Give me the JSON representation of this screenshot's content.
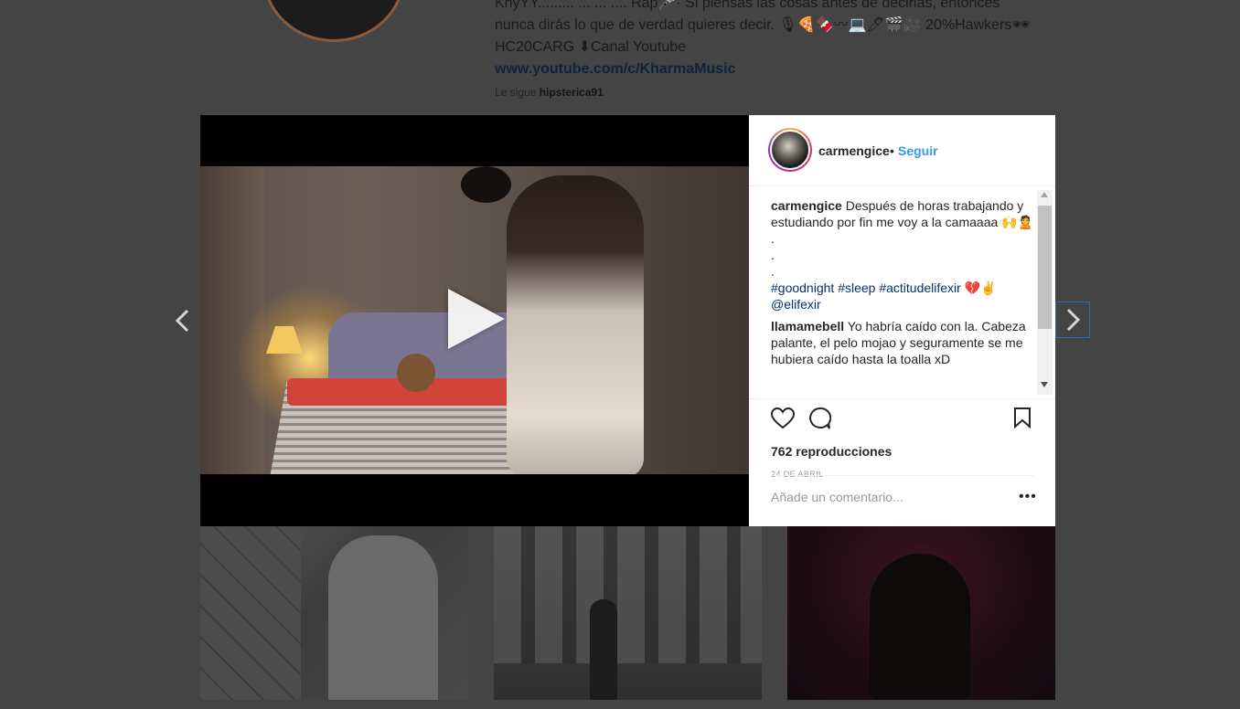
{
  "profile_bg": {
    "bio_line1": "KhyYY......... ... ... ....  Rap🎤· Si piensas las cosas antes de decirlas, entonces",
    "bio_line2": "nunca dirás lo que de verdad quieres decir. 🎙🍕🍫〰💻🖊🎬🎥  20%Hawkers🕶",
    "bio_line3": "HC20CARG ⬇Canal Youtube",
    "link": "www.youtube.com/c/KharmaMusic",
    "followed_by_label": "Le sigue",
    "followed_by_user": "hipsterica91"
  },
  "post": {
    "username": "carmengice",
    "separator": "•",
    "follow_label": "Seguir",
    "caption_user": "carmengice",
    "caption_text": "Después de horas trabajando y estudiando por fin me voy a la camaaaa 🙌🙎",
    "caption_dots": [
      ".",
      ".",
      "."
    ],
    "hashtags": [
      "#goodnight",
      "#sleep",
      "#actitudelifexir"
    ],
    "hashtag_emoji": "💔✌",
    "mention": "@elifexir",
    "comment_user": "llamamebell",
    "comment_text": "Yo habría caído con la. Cabeza palante, el pelo mojao y seguramente se me hubiera caído hasta la toalla xD",
    "views": "762 reproducciones",
    "date": "24 DE ABRIL",
    "comment_placeholder": "Añade un comentario...",
    "more_label": "•••"
  },
  "colors": {
    "accent": "#3897f0",
    "hashtag": "#003569",
    "overlay": "#444444"
  },
  "icons": {
    "like": "heart-icon",
    "comment": "comment-icon",
    "save": "bookmark-icon",
    "play": "play-icon",
    "prev": "chevron-left-icon",
    "next": "chevron-right-icon"
  }
}
